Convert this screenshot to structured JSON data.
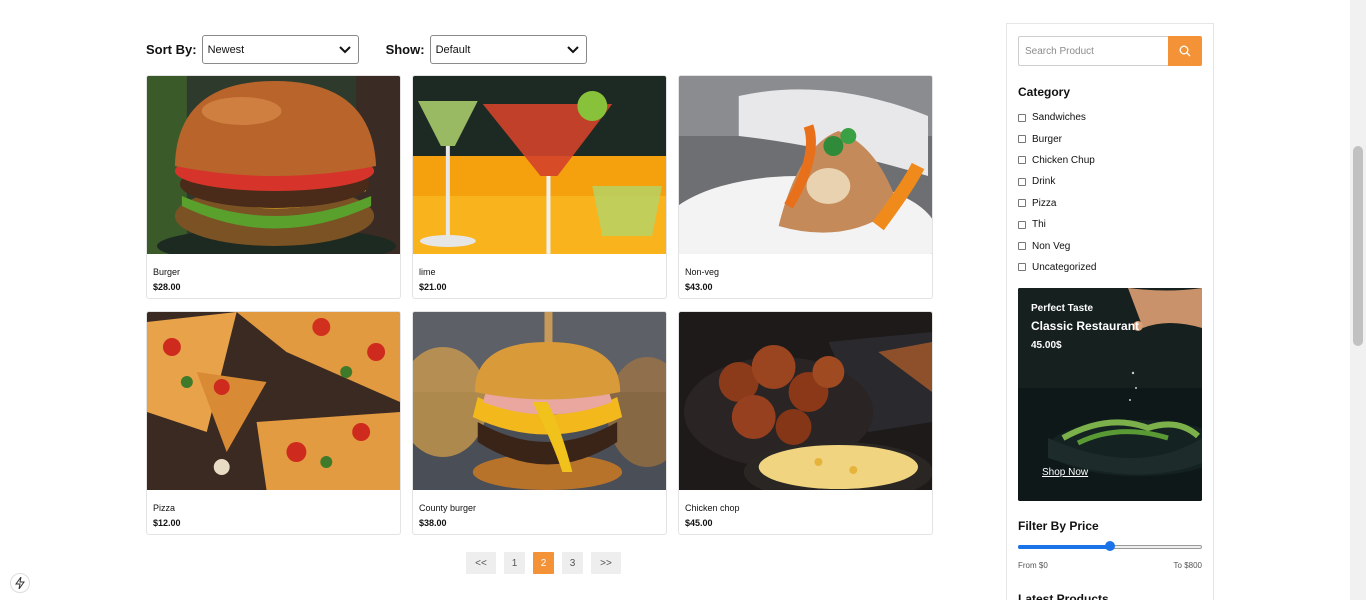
{
  "toolbar": {
    "sort_label": "Sort By:",
    "sort_value": "Newest",
    "show_label": "Show:",
    "show_value": "Default"
  },
  "products": [
    {
      "name": "Burger",
      "price": "$28.00",
      "image_icon": "burger-image"
    },
    {
      "name": "lime",
      "price": "$21.00",
      "image_icon": "cocktail-image"
    },
    {
      "name": "Non-veg",
      "price": "$43.00",
      "image_icon": "plated-dish-image"
    },
    {
      "name": "Pizza",
      "price": "$12.00",
      "image_icon": "pizza-image"
    },
    {
      "name": "County burger",
      "price": "$38.00",
      "image_icon": "cheeseburger-image"
    },
    {
      "name": "Chicken chop",
      "price": "$45.00",
      "image_icon": "fried-chicken-image"
    }
  ],
  "pagination": {
    "prev": "<<",
    "pages": [
      "1",
      "2",
      "3"
    ],
    "current": "2",
    "next": ">>"
  },
  "sidebar": {
    "search_placeholder": "Search Product",
    "category_title": "Category",
    "categories": [
      "Sandwiches",
      "Burger",
      "Chicken Chup",
      "Drink",
      "Pizza",
      "Thi",
      "Non Veg",
      "Uncategorized"
    ],
    "promo": {
      "subtitle": "Perfect Taste",
      "title": "Classic Restaurant",
      "price": "45.00$",
      "link": "Shop Now"
    },
    "filter_title": "Filter By Price",
    "price_from": "From $0",
    "price_to": "To $800",
    "price_slider_fraction": 0.5,
    "latest_title": "Latest Products"
  },
  "colors": {
    "accent": "#f39237",
    "slider": "#1a73e8"
  }
}
